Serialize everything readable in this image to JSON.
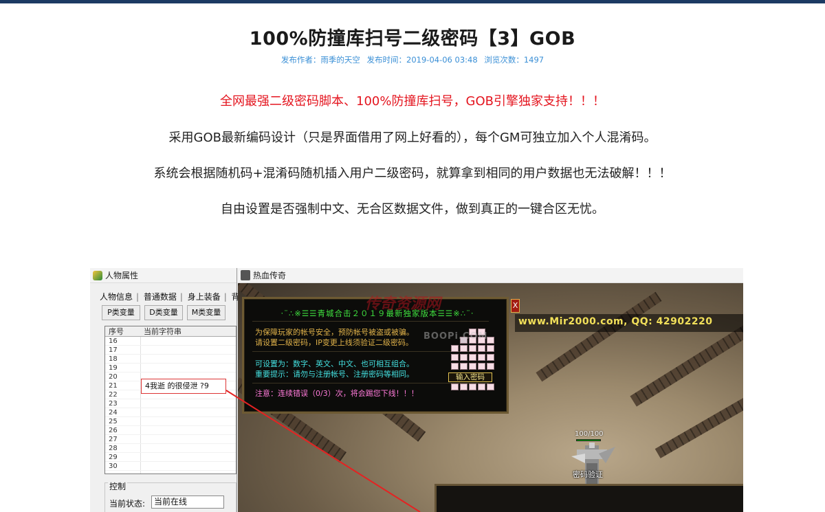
{
  "article": {
    "title": "100%防撞库扫号二级密码【3】GOB",
    "meta": {
      "author_label": "发布作者：雨季的天空",
      "time_label": "发布时间：2019-04-06 03:48",
      "views_label": "浏览次数：1497"
    },
    "paragraphs": {
      "p1": "全网最强二级密码脚本、100%防撞库扫号，GOB引擎独家支持！！！",
      "p2": "采用GOB最新编码设计（只是界面借用了网上好看的），每个GM可独立加入个人混淆码。",
      "p3": "系统会根据随机码+混淆码随机插入用户二级密码，就算拿到相同的用户数据也无法破解！！！",
      "p4": "自由设置是否强制中文、无合区数据文件，做到真正的一键合区无忧。"
    },
    "colors": {
      "highlight": "#e4151f",
      "meta": "#3a8fd6",
      "topbar": "#1c3a63"
    }
  },
  "screenshot": {
    "left_window": {
      "title": "人物属性",
      "menu": [
        "人物信息",
        "普通数据",
        "身上装备",
        "背"
      ],
      "tabs": [
        "P类变量",
        "D类变量",
        "M类变量"
      ],
      "grid_headers": [
        "序号",
        "当前字符串"
      ],
      "rows": [
        "16",
        "17",
        "18",
        "19",
        "20",
        "21",
        "22",
        "23",
        "24",
        "25",
        "26",
        "27",
        "28",
        "29",
        "30"
      ],
      "highlight_value": "4我逝  的很侵泄  ?9",
      "control_label": "控制",
      "status_label": "当前状态:",
      "status_value": "当前在线"
    },
    "right_window": {
      "title": "热血传奇",
      "dialog_title": "·¨∴※☰☰青城合击２０１９最新独家版本☰☰※∴¨·",
      "lines": {
        "l1": "为保障玩家的帐号安全，预防帐号被盗或被骗。",
        "l2": "请设置二级密码，IP变更上线须验证二级密码。",
        "l3": "可设置为：数字、英文、中文、也可相互组合。",
        "l4": "重要提示：请勿与注册帐号、注册密码等相同。",
        "l5": "注意：连续错误（0/3）次，将会踢您下线！！！"
      },
      "close_label": "X",
      "input_button": "输入密码",
      "site": "www.Mir2000.com, QQ: 42902220",
      "hp": "100/100",
      "char_name": "密码验证",
      "watermark": "传奇资源网",
      "watermark2": "BOOPi.COM"
    }
  }
}
